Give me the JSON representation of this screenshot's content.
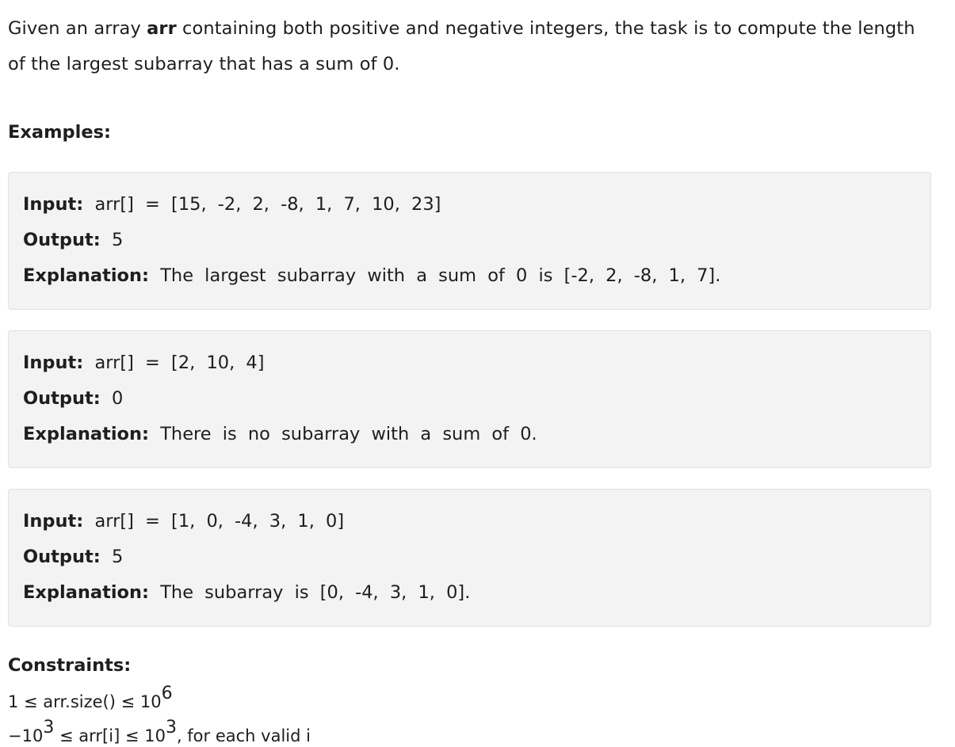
{
  "intro": {
    "before": "Given an array ",
    "variable": "arr",
    "after": " containing both positive and negative integers, the task is to compute the length of the largest subarray that has a sum of 0."
  },
  "examples_heading": "Examples:",
  "labels": {
    "input": "Input:",
    "output": "Output:",
    "explanation": "Explanation:"
  },
  "examples": [
    {
      "input": "arr[] = [15, -2, 2, -8, 1, 7, 10, 23]",
      "output": "5",
      "explanation": "The largest subarray with a sum of 0 is [-2, 2, -8, 1, 7]."
    },
    {
      "input": "arr[] = [2, 10, 4]",
      "output": "0",
      "explanation": "There is no subarray with a sum of 0."
    },
    {
      "input": "arr[] = [1, 0, -4, 3, 1, 0]",
      "output": "5",
      "explanation": "The subarray is [0, -4, 3, 1, 0]."
    }
  ],
  "constraints_heading": "Constraints:",
  "constraints": {
    "c1": {
      "text": "1 ≤ arr.size() ≤ 10",
      "exp": "6"
    },
    "c2": {
      "part1": "−10",
      "exp1": "3",
      "part2": " ≤ arr[i] ≤ 10",
      "exp2": "3",
      "suffix": ", for each valid i"
    }
  }
}
